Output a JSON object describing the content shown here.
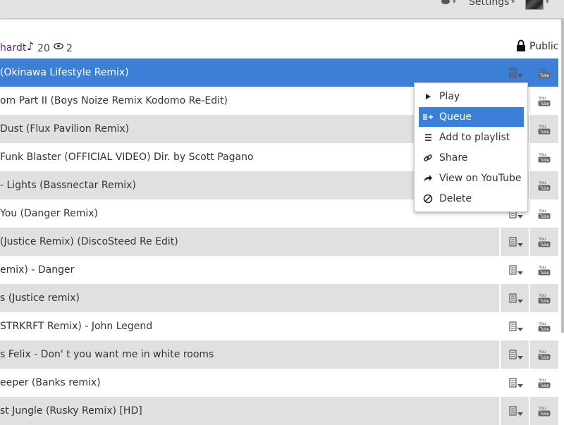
{
  "topbar": {
    "settings_label": "Settings",
    "caret": "▾"
  },
  "playlist": {
    "owner": "hardt",
    "track_count": "20",
    "view_count": "2",
    "privacy": "Public"
  },
  "tracks": [
    {
      "title": "(Okinawa Lifestyle Remix)"
    },
    {
      "title": "om Part II (Boys Noize Remix Kodomo Re-Edit)"
    },
    {
      "title": " Dust (Flux Pavilion Remix)"
    },
    {
      "title": " Funk Blaster (OFFICIAL VIDEO) Dir. by Scott Pagano"
    },
    {
      "title": "- Lights (Bassnectar Remix)"
    },
    {
      "title": " You (Danger Remix)"
    },
    {
      "title": "(Justice Remix) (DiscoSteed Re Edit)"
    },
    {
      "title": "emix) - Danger"
    },
    {
      "title": "s (Justice remix)"
    },
    {
      "title": "STRKRFT Remix) - John Legend"
    },
    {
      "title": "s Felix - Don' t you want me in white rooms"
    },
    {
      "title": "eeper (Banks remix)"
    },
    {
      "title": "st Jungle (Rusky Remix) [HD]"
    }
  ],
  "context_menu": {
    "items": [
      {
        "label": "Play",
        "icon": "play-icon"
      },
      {
        "label": "Queue",
        "icon": "queue-icon"
      },
      {
        "label": "Add to playlist",
        "icon": "list-icon"
      },
      {
        "label": "Share",
        "icon": "link-icon"
      },
      {
        "label": "View on YouTube",
        "icon": "share-arrow-icon"
      },
      {
        "label": "Delete",
        "icon": "prohibit-icon"
      }
    ],
    "highlighted_index": 1
  },
  "colors": {
    "accent": "#3b7fd6",
    "row_alt": "#e0e0e0",
    "owner": "#6b1f7a"
  }
}
